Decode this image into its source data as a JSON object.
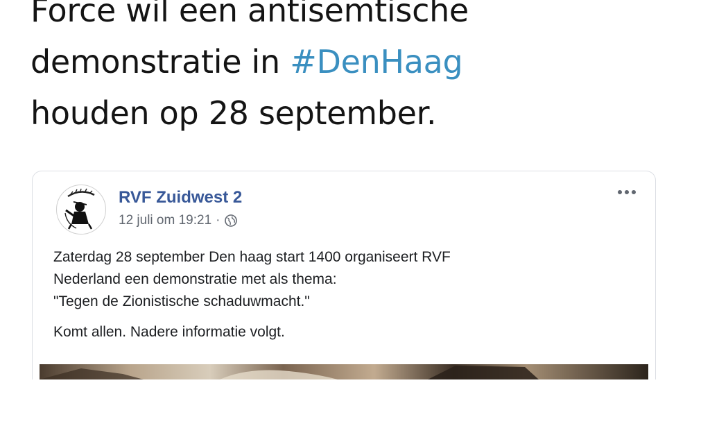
{
  "tweet": {
    "line1": "Force wil een antisemtische",
    "line2_text": "demonstratie in ",
    "hashtag": "#DenHaag",
    "line3": "houden op 28 september."
  },
  "post": {
    "page_name": "RVF Zuidwest 2",
    "timestamp": "12 juli om 19:21",
    "separator": "·",
    "privacy_icon": "globe-icon",
    "more_icon": "more-options-icon",
    "body_line1": "Zaterdag 28 september Den haag start 1400 organiseert RVF",
    "body_line2": "Nederland een demonstratie met als thema:",
    "body_line3": "\"Tegen de Zionistische schaduwmacht.\"",
    "body_line4": "Komt allen. Nadere informatie volgt."
  },
  "colors": {
    "hashtag": "#3a8fc0",
    "page_name": "#385898",
    "meta_text": "#616770",
    "card_border": "#dcdfe4"
  }
}
